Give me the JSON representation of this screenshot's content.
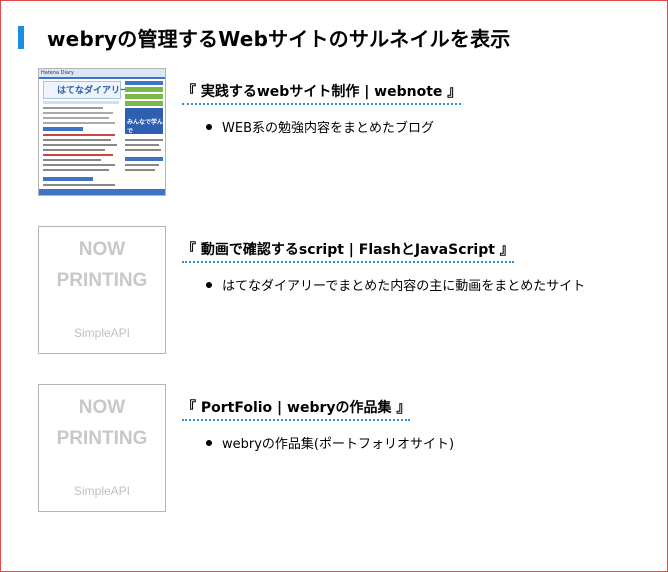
{
  "heading": {
    "text": "webryの管理するWebサイトのサルネイルを表示"
  },
  "sites": [
    {
      "title": "『 実践するwebサイト制作 | webnote 』",
      "description": "WEB系の勉強内容をまとめたブログ",
      "thumbnail": "screenshot",
      "thumb_text": {
        "header": "Hatena Diary",
        "logo": "はてなダイアリー",
        "side": "みんなで学んで"
      }
    },
    {
      "title": "『 動画で確認するscript | FlashとJavaScript 』",
      "description": "はてなダイアリーでまとめた内容の主に動画をまとめたサイト",
      "thumbnail": "placeholder",
      "placeholder": {
        "line1": "NOW",
        "line2": "PRINTING",
        "provider": "SimpleAPI"
      }
    },
    {
      "title": "『 PortFolio | webryの作品集 』",
      "description": "webryの作品集(ポートフォリオサイト)",
      "thumbnail": "placeholder",
      "placeholder": {
        "line1": "NOW",
        "line2": "PRINTING",
        "provider": "SimpleAPI"
      }
    }
  ],
  "colors": {
    "accent": "#1a8ee0",
    "frame_border": "#e24a4a",
    "placeholder_text": "#c8c8c8"
  }
}
